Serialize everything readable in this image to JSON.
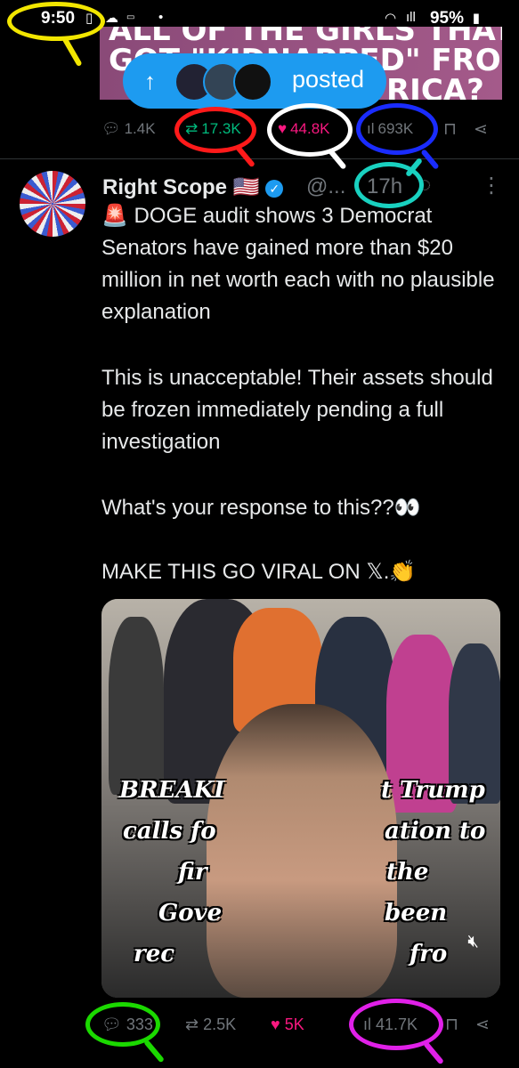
{
  "status_bar": {
    "time": "9:50",
    "battery": "95%",
    "icons": [
      "cloud-icon",
      "wifi-icon",
      "signal-icon",
      "battery-icon"
    ]
  },
  "banner": {
    "line1": "ALL OF THE GIRLS THAT",
    "line2": "GOT \"KIDNAPPED\" FROM",
    "line3": "RICA?"
  },
  "posted_pill": {
    "label": "posted"
  },
  "top_stats": {
    "replies": "1.4K",
    "reposts": "17.3K",
    "likes": "44.8K",
    "views": "693K"
  },
  "tweet": {
    "name": "Right Scope",
    "flag": "🇺🇸",
    "handle": "@...",
    "time_ago": "17h",
    "paragraphs": [
      "🚨 DOGE audit shows 3 Democrat Senators have gained more than $20 million in net worth each with no plausible explanation",
      "This is unacceptable! Their assets should be frozen immediately pending a full investigation",
      "What's your response to this??👀",
      "MAKE THIS GO VIRAL ON 𝕏.👏"
    ],
    "video_captions": [
      "BREAKI",
      "t Trump",
      "calls fo",
      "ation to",
      "fir",
      "the",
      "Gove",
      "been",
      "rec",
      "fro"
    ],
    "stats": {
      "replies": "333",
      "reposts": "2.5K",
      "likes": "5K",
      "views": "41.7K"
    }
  },
  "colors": {
    "accent": "#1d9bf0",
    "repost_green": "#00ba7c",
    "like_pink": "#f91880",
    "circle_yellow": "#f2e600",
    "circle_red": "#ff1a1a",
    "circle_white": "#ffffff",
    "circle_blue": "#1a2cff",
    "circle_teal": "#19d1c0",
    "circle_green": "#1bd900",
    "circle_magenta": "#e020e8"
  }
}
